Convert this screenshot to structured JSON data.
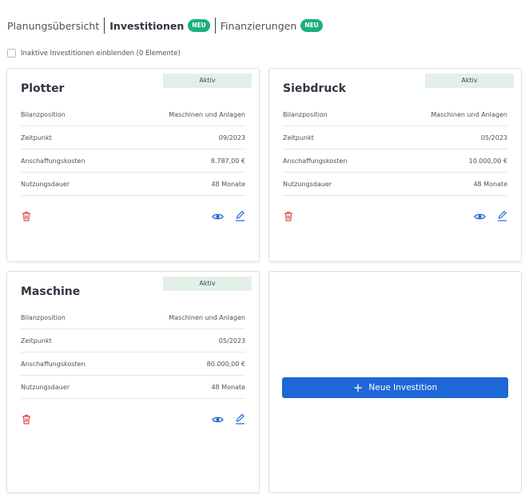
{
  "tabs": [
    {
      "label": "Planungsübersicht"
    },
    {
      "label": "Investitionen",
      "badge": "NEU"
    },
    {
      "label": "Finanzierungen",
      "badge": "NEU"
    }
  ],
  "filter": {
    "label": "Inaktive Investitionen einblenden (0 Elemente)"
  },
  "cards": [
    {
      "title": "Plotter",
      "status": "Aktiv",
      "rows": [
        {
          "label": "Bilanzposition",
          "value": "Maschinen und Anlagen"
        },
        {
          "label": "Zeitpunkt",
          "value": "09/2023"
        },
        {
          "label": "Anschaffungskosten",
          "value": "8.787,00 €"
        },
        {
          "label": "Nutzungsdauer",
          "value": "48 Monate"
        }
      ]
    },
    {
      "title": "Siebdruck",
      "status": "Aktiv",
      "rows": [
        {
          "label": "Bilanzposition",
          "value": "Maschinen und Anlagen"
        },
        {
          "label": "Zeitpunkt",
          "value": "05/2023"
        },
        {
          "label": "Anschaffungskosten",
          "value": "10.000,00 €"
        },
        {
          "label": "Nutzungsdauer",
          "value": "48 Monate"
        }
      ]
    },
    {
      "title": "Maschine",
      "status": "Aktiv",
      "rows": [
        {
          "label": "Bilanzposition",
          "value": "Maschinen und Anlagen"
        },
        {
          "label": "Zeitpunkt",
          "value": "05/2023"
        },
        {
          "label": "Anschaffungskosten",
          "value": "80.000,00 €"
        },
        {
          "label": "Nutzungsdauer",
          "value": "48 Monate"
        }
      ]
    }
  ],
  "add_button": {
    "label": "Neue Investition",
    "icon": "plus-icon"
  },
  "colors": {
    "accent": "#1e67d6",
    "badge": "#1bb07a",
    "status_bg": "#e2f0e8",
    "delete": "#e04848"
  }
}
